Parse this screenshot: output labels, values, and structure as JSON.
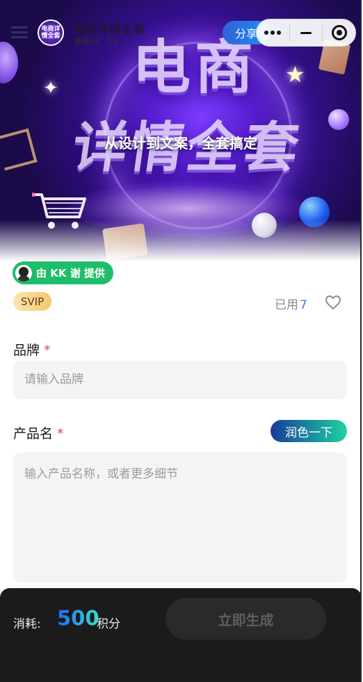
{
  "header": {
    "menu_icon": "menu-icon",
    "app_logo_text": "电商详情全套",
    "title": "电商详情全套",
    "subtitle": "余积分：14",
    "share_label": "分享",
    "capsule_icons": [
      "more-dots-icon",
      "minimize-icon",
      "close-target-icon"
    ]
  },
  "hero": {
    "title_line1": "电商",
    "title_line2": "详情全套",
    "subtitle": "从设计到文案，全套搞定"
  },
  "provider": {
    "label": "由 KK 谢 提供"
  },
  "meta": {
    "badge": "SVIP",
    "used_label": "已用",
    "used_count": "7",
    "favorite_icon": "heart-outline-icon"
  },
  "form": {
    "brand": {
      "label": "品牌",
      "required_mark": "*",
      "placeholder": "请输入品牌"
    },
    "product": {
      "label": "产品名",
      "required_mark": "*",
      "polish_label": "润色一下",
      "placeholder": "输入产品名称，或者更多细节"
    }
  },
  "footer": {
    "cost_label": "消耗:",
    "cost_value": "500",
    "cost_unit": "积分",
    "generate_label": "立即生成"
  },
  "colors": {
    "provider_green": "#1ebd6a",
    "link_blue": "#2f7de1",
    "required_red": "#e04545",
    "bottom_bar": "#1b1b1b",
    "hero_purple": "#5a1fd1"
  }
}
